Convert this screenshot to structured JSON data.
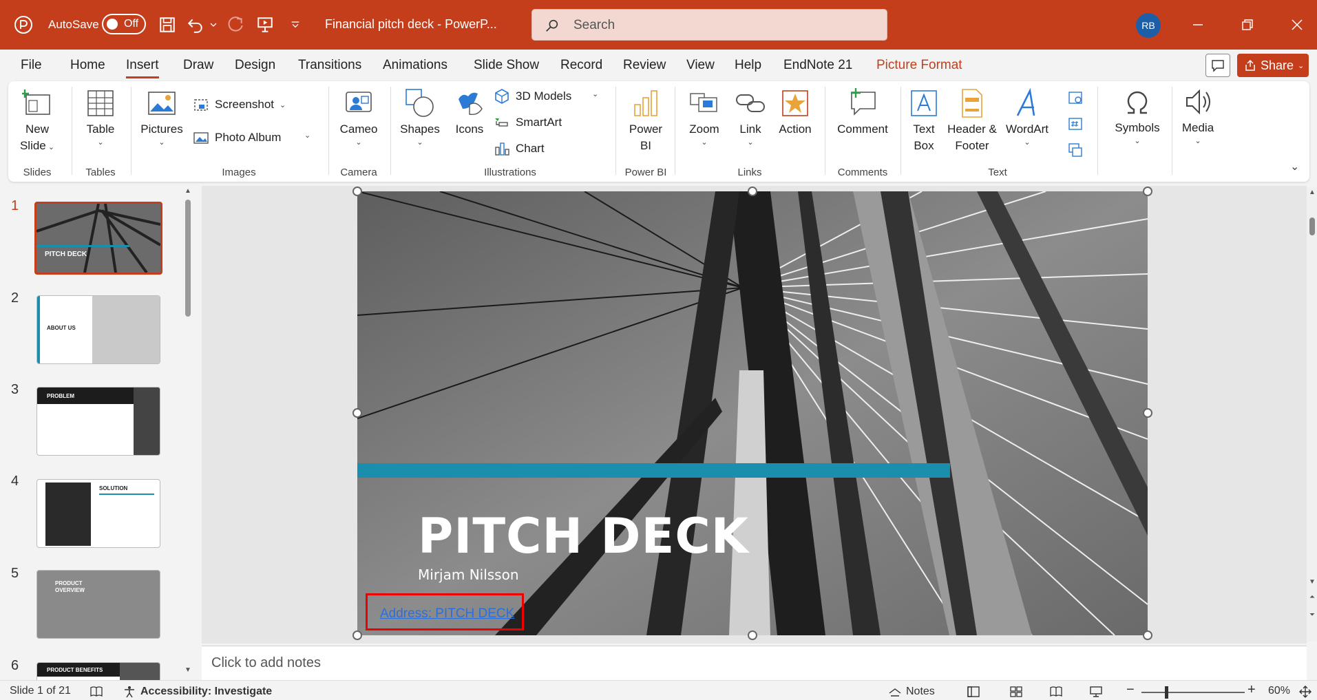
{
  "app": {
    "autosave_label": "AutoSave",
    "autosave_state": "Off",
    "doc_title": "Financial pitch deck  -  PowerP...",
    "search_placeholder": "Search",
    "user_initials": "RB"
  },
  "colors": {
    "brand": "#c43e1c",
    "accent_bar": "#1a8fad",
    "selection": "#e00000"
  },
  "menu": {
    "tabs": [
      "File",
      "Home",
      "Insert",
      "Draw",
      "Design",
      "Transitions",
      "Animations",
      "Slide Show",
      "Record",
      "Review",
      "View",
      "Help",
      "EndNote 21",
      "Picture Format"
    ],
    "active": "Insert",
    "share_label": "Share"
  },
  "ribbon": {
    "new_slide": "New Slide",
    "table": "Table",
    "pictures": "Pictures",
    "screenshot": "Screenshot",
    "photo_album": "Photo Album",
    "cameo": "Cameo",
    "shapes": "Shapes",
    "icons": "Icons",
    "models_3d": "3D Models",
    "smartart": "SmartArt",
    "chart": "Chart",
    "power_bi": "Power BI",
    "zoom": "Zoom",
    "link": "Link",
    "action": "Action",
    "comment": "Comment",
    "text_box": "Text Box",
    "header_footer": "Header & Footer",
    "wordart": "WordArt",
    "symbols": "Symbols",
    "media": "Media",
    "groups": {
      "slides": "Slides",
      "tables": "Tables",
      "images": "Images",
      "camera": "Camera",
      "illustrations": "Illustrations",
      "power_bi": "Power BI",
      "links": "Links",
      "comments": "Comments",
      "text": "Text"
    }
  },
  "thumbnails": [
    {
      "num": "1",
      "title": "PITCH DECK"
    },
    {
      "num": "2",
      "title": "ABOUT US"
    },
    {
      "num": "3",
      "title": "PROBLEM"
    },
    {
      "num": "4",
      "title": "SOLUTION"
    },
    {
      "num": "5",
      "title": "PRODUCT OVERVIEW"
    },
    {
      "num": "6",
      "title": "PRODUCT BENEFITS"
    }
  ],
  "slide": {
    "title": "PITCH DECK",
    "author": "Mirjam Nilsson",
    "address": "Address: PITCH DECK"
  },
  "notes_placeholder": "Click to add notes",
  "status": {
    "slide_counter": "Slide 1 of 21",
    "accessibility": "Accessibility: Investigate",
    "notes": "Notes",
    "zoom": "60%"
  }
}
